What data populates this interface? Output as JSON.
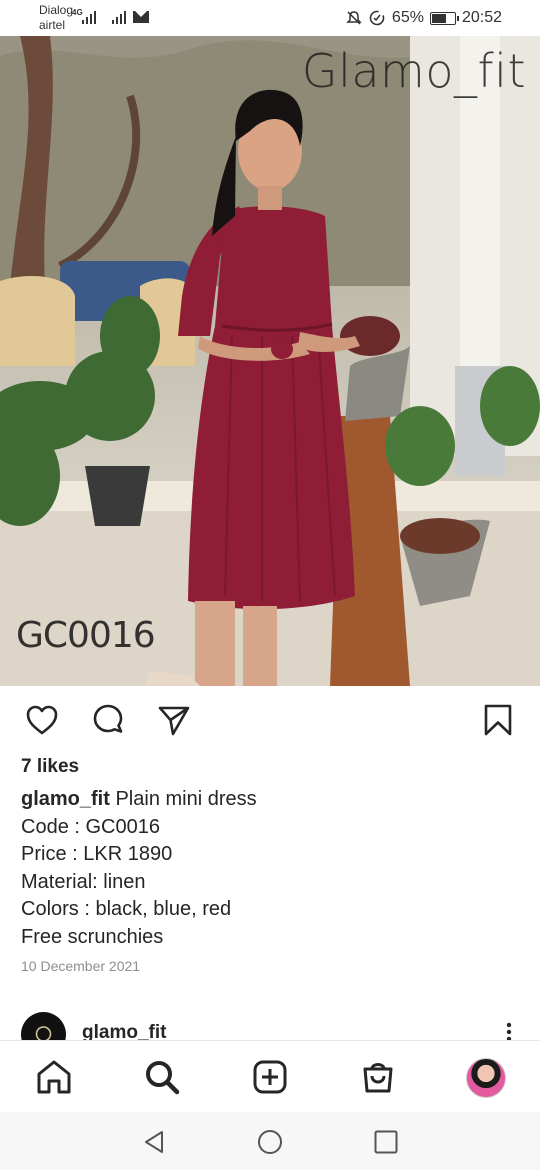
{
  "status_bar": {
    "carrier_top": "Dialog",
    "carrier_bottom": "airtel",
    "network": "4G",
    "battery_percent": "65%",
    "time": "20:52",
    "icons": [
      "signal-icon",
      "mail-icon",
      "mute-icon",
      "data-saver-icon",
      "battery-icon"
    ]
  },
  "post": {
    "image_watermark": "Glamo_fit",
    "image_code": "GC0016",
    "likes": "7 likes",
    "username": "glamo_fit",
    "caption_lines": [
      "Plain mini dress",
      "Code : GC0016",
      "Price : LKR 1890",
      "Material: linen",
      "Colors : black, blue, red",
      "Free scrunchies"
    ],
    "date": "10 December 2021",
    "actions": [
      "heart-icon",
      "comment-icon",
      "share-icon",
      "bookmark-icon"
    ]
  },
  "next_post": {
    "username": "glamo_fit"
  },
  "bottom_nav": [
    "home-icon",
    "search-icon",
    "new-post-icon",
    "shop-icon",
    "profile-avatar"
  ],
  "system_nav": [
    "back-icon",
    "home-circle-icon",
    "recents-icon"
  ],
  "colors": {
    "dress": "#8e1d35",
    "text": "#262626",
    "muted": "#8e8e8e"
  }
}
